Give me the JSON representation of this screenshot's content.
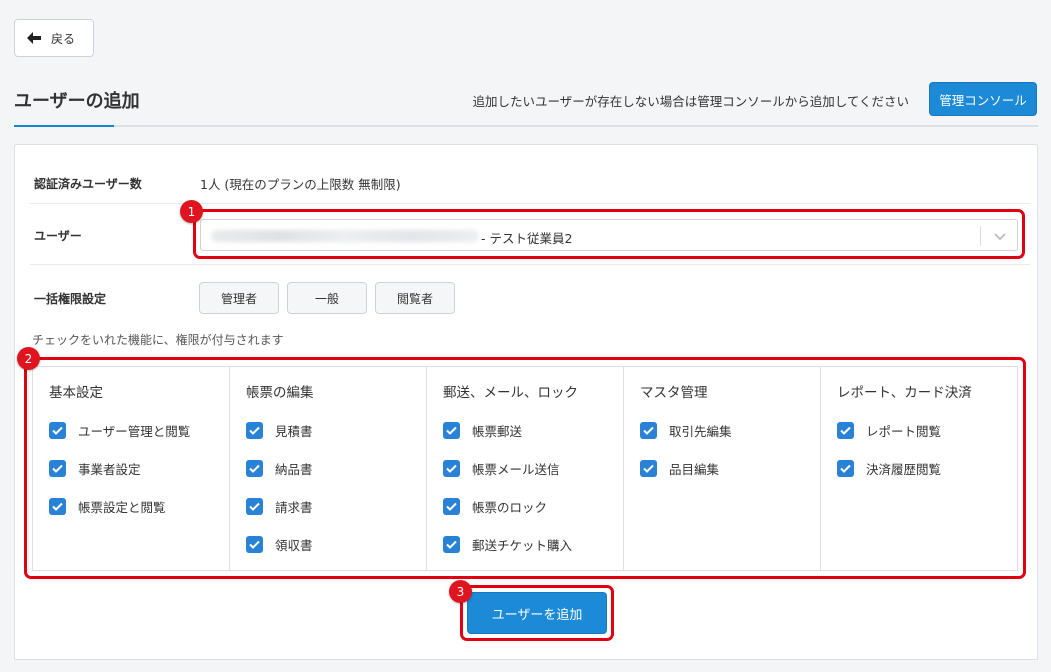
{
  "back_button": {
    "label": "戻る"
  },
  "header": {
    "title": "ユーザーの追加",
    "hint": "追加したいユーザーが存在しない場合は管理コンソールから追加してください",
    "console_button": "管理コンソール"
  },
  "form": {
    "verified_count": {
      "label": "認証済みユーザー数",
      "value": "1人 (現在のプランの上限数 無制限)"
    },
    "user": {
      "label": "ユーザー",
      "selected_suffix": "- テスト従業員2"
    },
    "bulk": {
      "label": "一括権限設定",
      "buttons": [
        "管理者",
        "一般",
        "閲覧者"
      ]
    },
    "note": "チェックをいれた機能に、権限が付与されます"
  },
  "permissions": [
    {
      "title": "基本設定",
      "items": [
        "ユーザー管理と閲覧",
        "事業者設定",
        "帳票設定と閲覧"
      ]
    },
    {
      "title": "帳票の編集",
      "items": [
        "見積書",
        "納品書",
        "請求書",
        "領収書"
      ]
    },
    {
      "title": "郵送、メール、ロック",
      "items": [
        "帳票郵送",
        "帳票メール送信",
        "帳票のロック",
        "郵送チケット購入"
      ]
    },
    {
      "title": "マスタ管理",
      "items": [
        "取引先編集",
        "品目編集"
      ]
    },
    {
      "title": "レポート、カード決済",
      "items": [
        "レポート閲覧",
        "決済履歴閲覧"
      ]
    }
  ],
  "submit_button": "ユーザーを追加",
  "annotations": [
    "1",
    "2",
    "3"
  ],
  "colors": {
    "accent": "#1c8ad6",
    "highlight": "#e00012",
    "checkbox": "#2a82d6"
  }
}
